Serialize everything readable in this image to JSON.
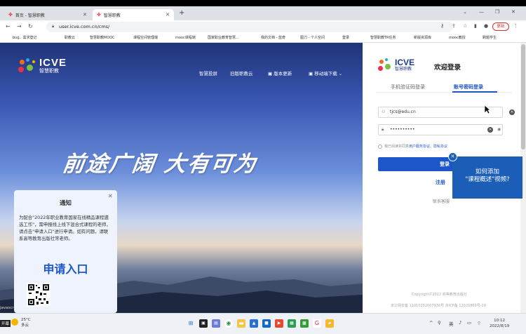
{
  "browser": {
    "tabs": [
      {
        "label": "首页 - 智慧职教",
        "active": false
      },
      {
        "label": "智慧职教",
        "active": true
      }
    ],
    "url": "user.icve.com.cn/cms/",
    "profile_label": "更新",
    "bookmarks": [
      "bug、需求登记",
      "职教云",
      "智慧职教MOOC",
      "课程空间管理端",
      "mooc课程端",
      "国家职业教育智慧...",
      "我的文档 - 蓝奇",
      "图刀 - 个人空间",
      "登录",
      "智慧职教TR任务",
      "新版资源库",
      "mooc教授",
      "刷题学生"
    ]
  },
  "site": {
    "brand_en": "ICVE",
    "brand_cn": "智慧职教",
    "nav": [
      "智慧投屏",
      "旧版职教云",
      "版本更新",
      "移动端下载"
    ],
    "slogan": "前途广阔 大有可为",
    "status_url": "javascript:;"
  },
  "notice": {
    "title": "通知",
    "body": "为配合\"2022年职业教育国家在线精品课程遴选工作\"，需申报线上线下混合式课程的老师，请点击\"申请入口\"进行申请。如有问题，请联系高等教育出版社常老师。",
    "apply_label": "申请入口"
  },
  "login": {
    "welcome": "欢迎登录",
    "tab_sms": "手机验证码登录",
    "tab_password": "账号密码登录",
    "username": "tjcs@edu.cn",
    "password_mask": "••••••••••",
    "agree_prefix": "我已阅读并同意",
    "agree_links": "用户服务协议、隐私协议",
    "login_button": "登录",
    "register": "注册",
    "contact": "联系客服",
    "copyright": "Copyright©2022 高等教育出版社",
    "icp": "京公网安备 11010202007936号  京ICP备 12020869号-19"
  },
  "video_prompt": {
    "line1": "如何添加",
    "line2": "\"课程概述\"视频?"
  },
  "taskbar": {
    "temp": "25°C",
    "weather": "多云",
    "ime": "英",
    "time": "10:12",
    "date": "2022/8/19",
    "corner_label": "开幕"
  },
  "colors": {
    "accent": "#1d56c8",
    "video_prompt": "#1c5db8"
  }
}
